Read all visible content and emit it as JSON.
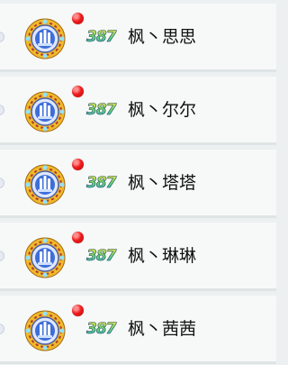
{
  "colors": {
    "row_background": "#f7f9f8",
    "divider": "#dfe4e4",
    "notification_dot": "#ef1d1d",
    "badge_ring": "#f0b92b",
    "badge_core": "#3e6ed9",
    "level_gradient": [
      "#ffe84a",
      "#68d86c",
      "#2aa6e2"
    ]
  },
  "list": {
    "items": [
      {
        "level": "387",
        "name": "枫丶思思",
        "badge_icon": "gear-badge-icon",
        "unread_indicator": "red-dot-icon"
      },
      {
        "level": "387",
        "name": "枫丶尔尔",
        "badge_icon": "gear-badge-icon",
        "unread_indicator": "red-dot-icon"
      },
      {
        "level": "387",
        "name": "枫丶塔塔",
        "badge_icon": "gear-badge-icon",
        "unread_indicator": "red-dot-icon"
      },
      {
        "level": "387",
        "name": "枫丶琳琳",
        "badge_icon": "gear-badge-icon",
        "unread_indicator": "red-dot-icon"
      },
      {
        "level": "387",
        "name": "枫丶茜茜",
        "badge_icon": "gear-badge-icon",
        "unread_indicator": "red-dot-icon"
      }
    ]
  }
}
